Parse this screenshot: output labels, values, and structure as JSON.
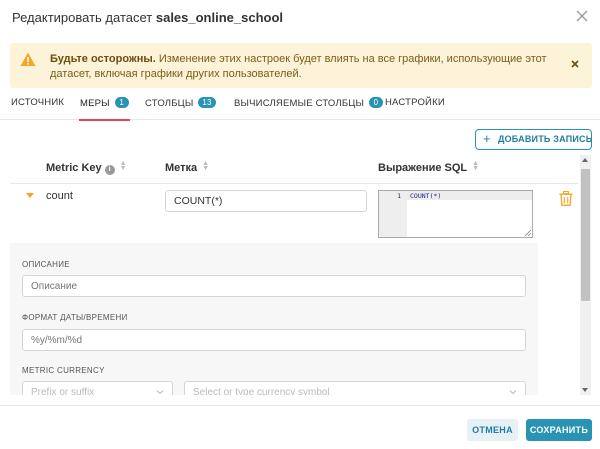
{
  "header": {
    "title_prefix": "Редактировать датасет",
    "dataset_name": "sales_online_school"
  },
  "warning": {
    "bold_text": "Будьте осторожны.",
    "text": "Изменение этих настроек будет влиять на все графики, использующие этот датасет, включая графики других пользователей."
  },
  "tabs": [
    {
      "label": "ИСТОЧНИК",
      "badge": null,
      "active": false
    },
    {
      "label": "МЕРЫ",
      "badge": "1",
      "active": true
    },
    {
      "label": "СТОЛБЦЫ",
      "badge": "13",
      "active": false
    },
    {
      "label": "ВЫЧИСЛЯЕМЫЕ СТОЛБЦЫ",
      "badge": "0",
      "active": false
    },
    {
      "label": "НАСТРОЙКИ",
      "badge": null,
      "active": false
    }
  ],
  "add_button": {
    "label": "ДОБАВИТЬ ЗАПИСЬ",
    "icon": "plus-icon"
  },
  "table": {
    "columns": [
      "Metric Key",
      "Метка",
      "Выражение SQL"
    ],
    "rows": [
      {
        "metric_key": "count",
        "label": "COUNT(*)",
        "sql_line_number": "1",
        "sql": "COUNT(*)"
      }
    ]
  },
  "details": {
    "description_label": "ОПИСАНИЕ",
    "description_placeholder": "Описание",
    "datetime_format_label": "ФОРМАТ ДАТЫ/ВРЕМЕНИ",
    "datetime_format_placeholder": "%y/%m/%d",
    "currency_label": "METRIC CURRENCY",
    "currency_position_placeholder": "Prefix or suffix",
    "currency_symbol_placeholder": "Select or type currency symbol"
  },
  "footer": {
    "cancel_label": "ОТМЕНА",
    "save_label": "СОХРАНИТЬ"
  },
  "colors": {
    "accent": "#2893b3",
    "active_tab_underline": "#e04355",
    "warning_bg": "#fdf3d8",
    "warning_icon": "#f5a623",
    "trash_icon": "#f5a623"
  }
}
